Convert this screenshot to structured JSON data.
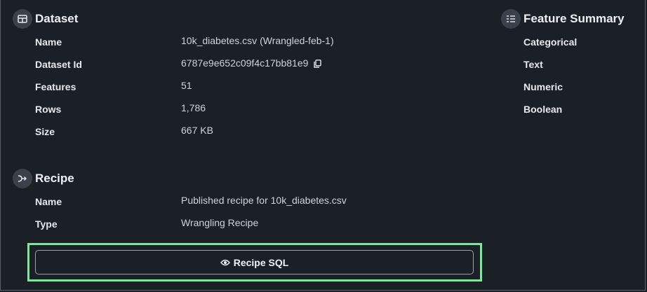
{
  "dataset": {
    "title": "Dataset",
    "rows": [
      {
        "label": "Name",
        "value": "10k_diabetes.csv (Wrangled-feb-1)"
      },
      {
        "label": "Dataset Id",
        "value": "6787e9e652c09f4c17bb81e9"
      },
      {
        "label": "Features",
        "value": "51"
      },
      {
        "label": "Rows",
        "value": "1,786"
      },
      {
        "label": "Size",
        "value": "667 KB"
      }
    ]
  },
  "feature_summary": {
    "title": "Feature Summary",
    "items": [
      "Categorical",
      "Text",
      "Numeric",
      "Boolean"
    ]
  },
  "recipe": {
    "title": "Recipe",
    "rows": [
      {
        "label": "Name",
        "value": "Published recipe for 10k_diabetes.csv"
      },
      {
        "label": "Type",
        "value": "Wrangling Recipe"
      }
    ],
    "button_label": "Recipe SQL"
  },
  "icons": {
    "dataset": "table-icon",
    "feature_summary": "list-icon",
    "recipe": "recipe-icon",
    "copy": "copy-icon",
    "eye": "eye-icon"
  },
  "colors": {
    "background": "#1b1f26",
    "highlight": "#7ee89a",
    "icon_bg": "#3b414a"
  }
}
